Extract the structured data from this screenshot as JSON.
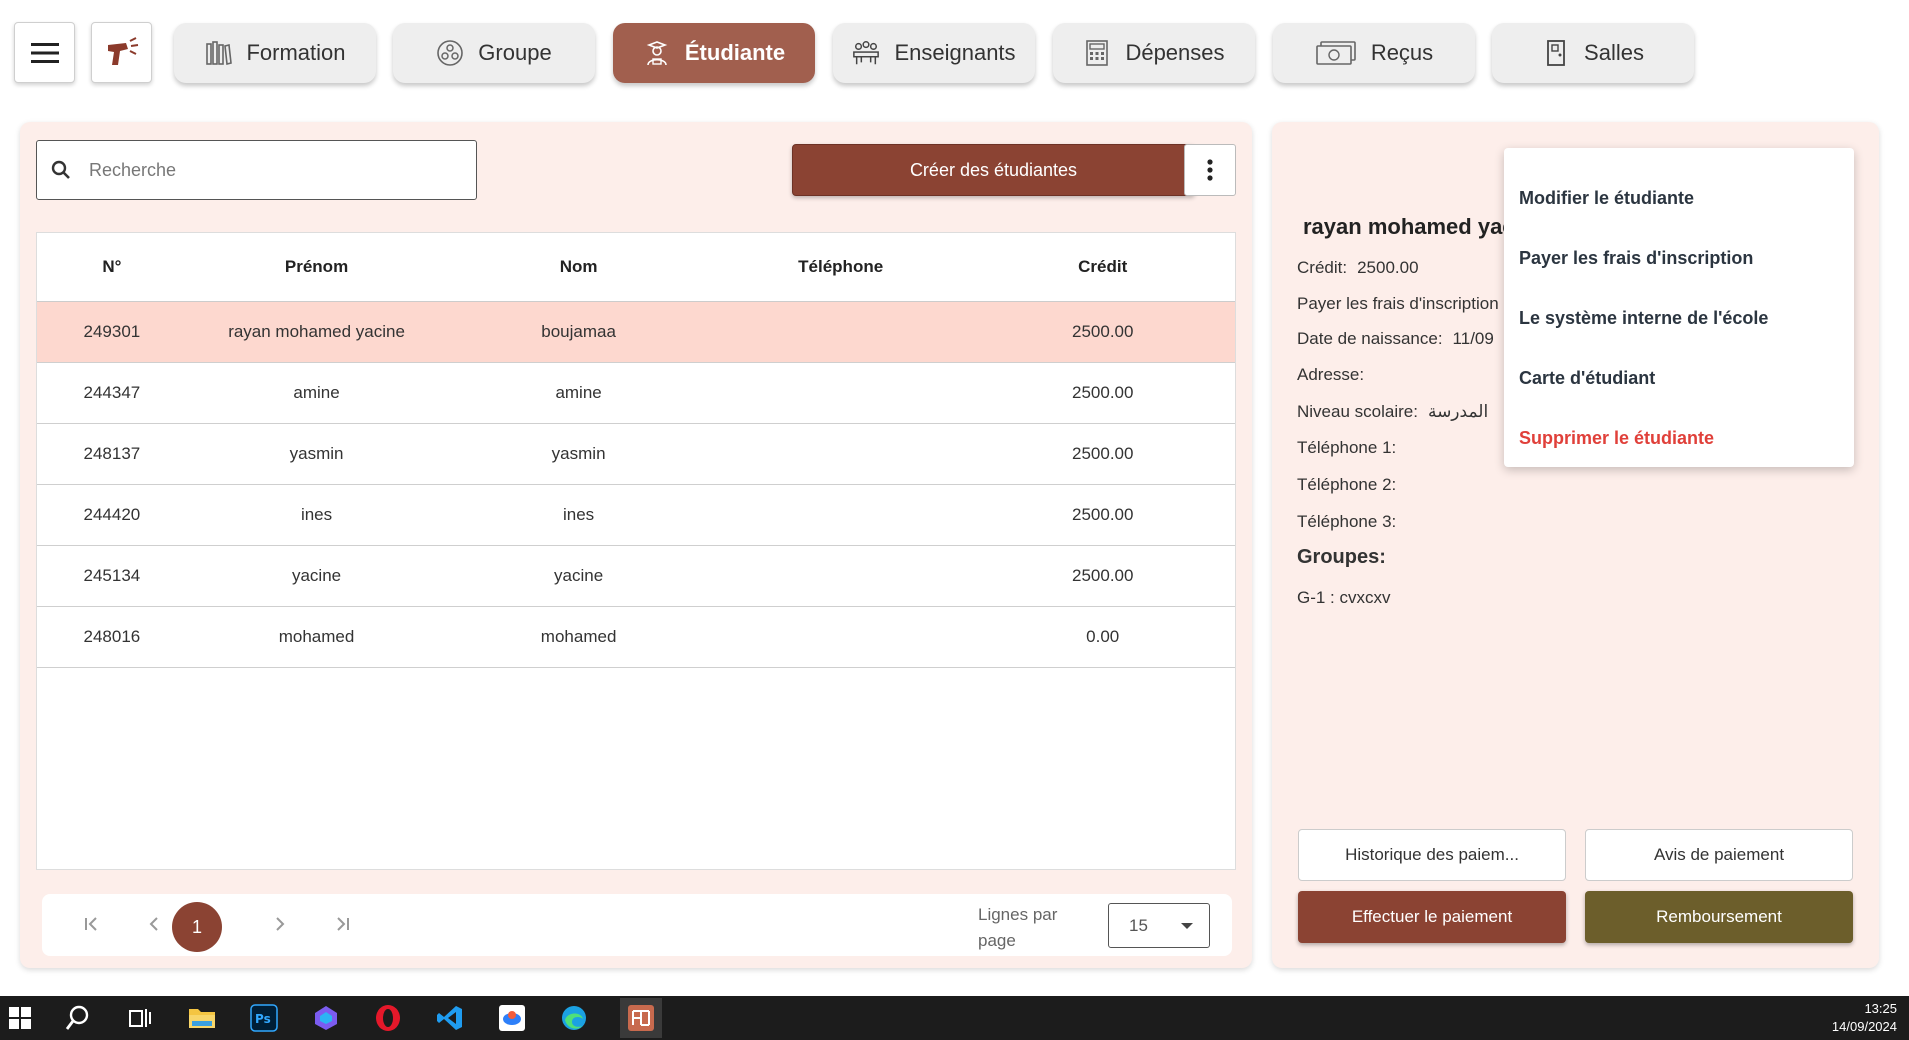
{
  "nav": {
    "tabs": [
      {
        "label": "Formation",
        "icon": "books-icon"
      },
      {
        "label": "Groupe",
        "icon": "group-icon"
      },
      {
        "label": "Étudiante",
        "icon": "student-icon",
        "active": true
      },
      {
        "label": "Enseignants",
        "icon": "teachers-icon"
      },
      {
        "label": "Dépenses",
        "icon": "calculator-icon"
      },
      {
        "label": "Reçus",
        "icon": "money-icon"
      },
      {
        "label": "Salles",
        "icon": "door-icon"
      }
    ]
  },
  "search": {
    "placeholder": "Recherche",
    "value": ""
  },
  "toolbar": {
    "create_label": "Créer des étudiantes"
  },
  "table": {
    "columns": [
      "N°",
      "Prénom",
      "Nom",
      "Téléphone",
      "Crédit"
    ],
    "rows": [
      {
        "no": "249301",
        "prenom": "rayan mohamed yacine",
        "nom": "boujamaa",
        "tel": "",
        "credit": "2500.00",
        "selected": true
      },
      {
        "no": "244347",
        "prenom": "amine",
        "nom": "amine",
        "tel": "",
        "credit": "2500.00"
      },
      {
        "no": "248137",
        "prenom": "yasmin",
        "nom": "yasmin",
        "tel": "",
        "credit": "2500.00"
      },
      {
        "no": "244420",
        "prenom": "ines",
        "nom": "ines",
        "tel": "",
        "credit": "2500.00"
      },
      {
        "no": "245134",
        "prenom": "yacine",
        "nom": "yacine",
        "tel": "",
        "credit": "2500.00"
      },
      {
        "no": "248016",
        "prenom": "mohamed",
        "nom": "mohamed",
        "tel": "",
        "credit": "0.00"
      }
    ]
  },
  "pagination": {
    "current_page": "1",
    "lines_label": "Lignes par page",
    "lines_value": "15"
  },
  "detail": {
    "name": "rayan mohamed yacine",
    "credit_label": "Crédit:",
    "credit_value": "2500.00",
    "fees_label": "Payer les frais d'inscription",
    "birth_label": "Date de naissance:",
    "birth_value": "11/09",
    "address_label": "Adresse:",
    "level_label": "Niveau scolaire:",
    "level_value": "المدرسة",
    "phone1_label": "Téléphone 1:",
    "phone2_label": "Téléphone 2:",
    "phone3_label": "Téléphone 3:",
    "groups_title": "Groupes:",
    "groups": [
      "G-1 : cvxcxv"
    ],
    "history_label": "Historique des paiem...",
    "notice_label": "Avis de paiement",
    "pay_label": "Effectuer le paiement",
    "refund_label": "Remboursement"
  },
  "menu": {
    "items": [
      {
        "label": "Modifier le étudiante"
      },
      {
        "label": "Payer les frais d'inscription"
      },
      {
        "label": "Le système interne de l'école"
      },
      {
        "label": "Carte d'étudiant"
      },
      {
        "label": "Supprimer le étudiante",
        "danger": true
      }
    ]
  },
  "taskbar": {
    "time": "13:25",
    "date": "14/09/2024"
  },
  "colors": {
    "accent": "#8b4333",
    "active_tab": "#a15f4e",
    "panel_bg": "#fdeeea",
    "selected_row": "#fdd8cf",
    "refund": "#6c5e2b",
    "danger": "#e0403a"
  }
}
